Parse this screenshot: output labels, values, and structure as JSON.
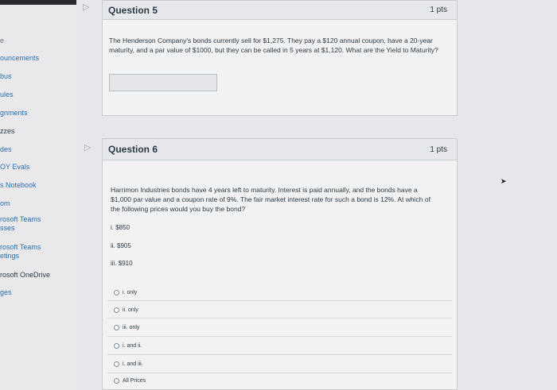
{
  "sidebar": {
    "items": [
      {
        "label": "e",
        "top": 0
      },
      {
        "label": "ouncements"
      },
      {
        "label": "bus"
      },
      {
        "label": "ules"
      },
      {
        "label": "gnments"
      },
      {
        "label": "zzes"
      },
      {
        "label": "des"
      },
      {
        "label": "OY Evals"
      },
      {
        "label": "s Notebook"
      },
      {
        "label": "om"
      },
      {
        "label": "rosoft Teams",
        "sub": "sses"
      },
      {
        "label": "rosoft Teams",
        "sub": "etings"
      },
      {
        "label": "rosoft OneDrive"
      },
      {
        "label": "ges"
      }
    ]
  },
  "q5": {
    "title": "Question 5",
    "points": "1 pts",
    "text": "The Henderson Company's bonds currently sell for $1,275. They pay a $120 annual coupon, have a 20-year maturity, and a par value of $1000, but they can be called in 5 years at $1,120. What are the Yield to Maturity?",
    "answer": ""
  },
  "q6": {
    "title": "Question 6",
    "points": "1 pts",
    "text": "Harrimon Industries bonds have 4 years left to maturity. Interest is paid annually, and the bonds have a $1,000 par value and a coupon rate of 9%. The fair market interest rate for such a bond is 12%. At which of the following prices would you buy the bond?",
    "options": [
      "i. $850",
      "ii. $905",
      "iii. $910"
    ],
    "choices": [
      "i. only",
      "ii. only",
      "iii. only",
      "i. and ii.",
      "i. and iii.",
      "All Prices"
    ]
  }
}
